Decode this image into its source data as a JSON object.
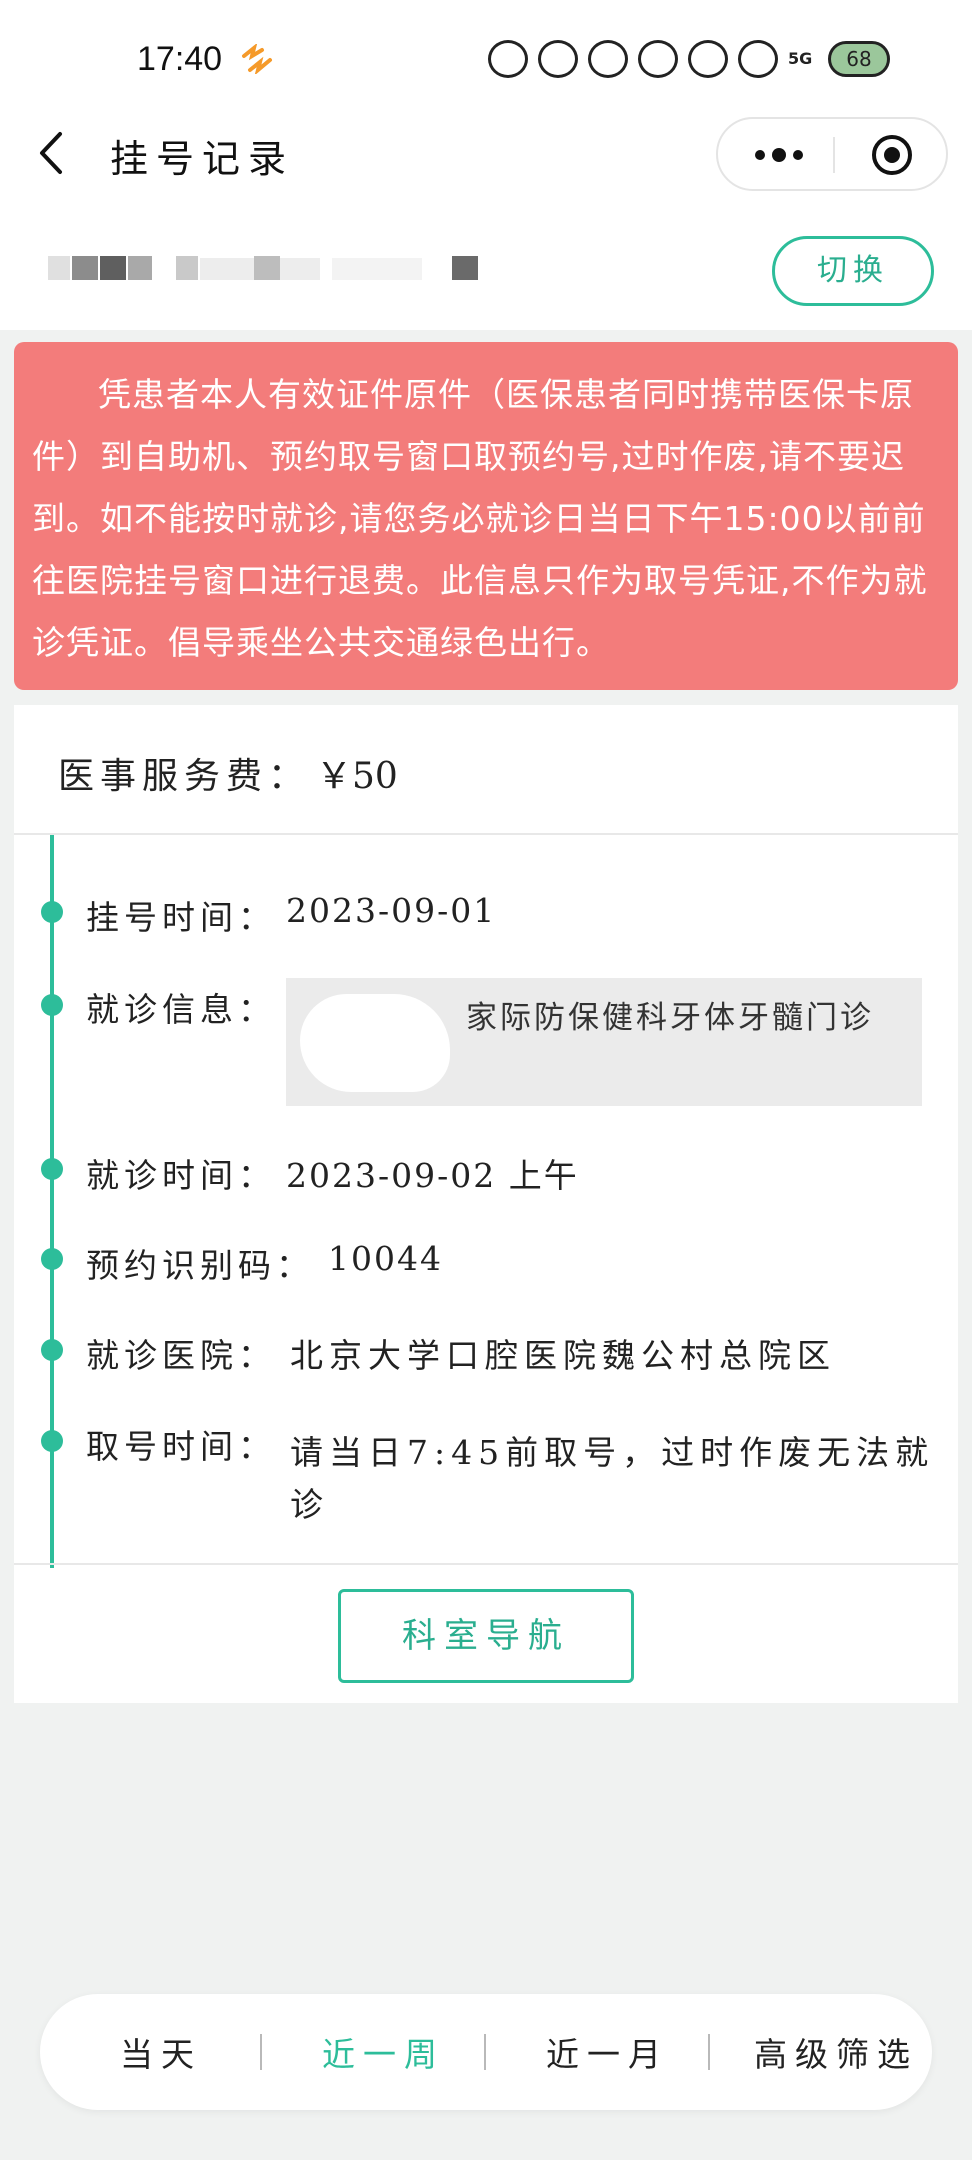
{
  "status_bar": {
    "time": "17:40",
    "signal": "5G",
    "battery": "68"
  },
  "header": {
    "title": "挂号记录"
  },
  "account": {
    "switch_label": "切换"
  },
  "notice": {
    "text": "凭患者本人有效证件原件（医保患者同时携带医保卡原件）到自助机、预约取号窗口取预约号,过时作废,请不要迟到。如不能按时就诊,请您务必就诊日当日下午15:00以前前往医院挂号窗口进行退费。此信息只作为取号凭证,不作为就诊凭证。倡导乘坐公共交通绿色出行。",
    "background_color": "#f37c7b"
  },
  "record": {
    "fee_label": "医事服务费：",
    "fee_value": "￥50",
    "register_time_label": "挂号时间：",
    "register_time_value": "2023-09-01",
    "visit_info_label": "就诊信息：",
    "visit_info_value": "家际防保健科牙体牙髓门诊",
    "visit_time_label": "就诊时间：",
    "visit_time_value": "2023-09-02 上午",
    "booking_code_label": "预约识别码：",
    "booking_code_value": "10044",
    "hospital_label": "就诊医院：",
    "hospital_value": "北京大学口腔医院魏公村总院区",
    "pickup_time_label": "取号时间：",
    "pickup_time_value": "请当日7:45前取号，过时作废无法就诊",
    "nav_button": "科室导航"
  },
  "filter": {
    "items": [
      "当天",
      "近一周",
      "近一月",
      "高级筛选"
    ],
    "active_index": 1,
    "accent_color": "#2dbd9a"
  }
}
